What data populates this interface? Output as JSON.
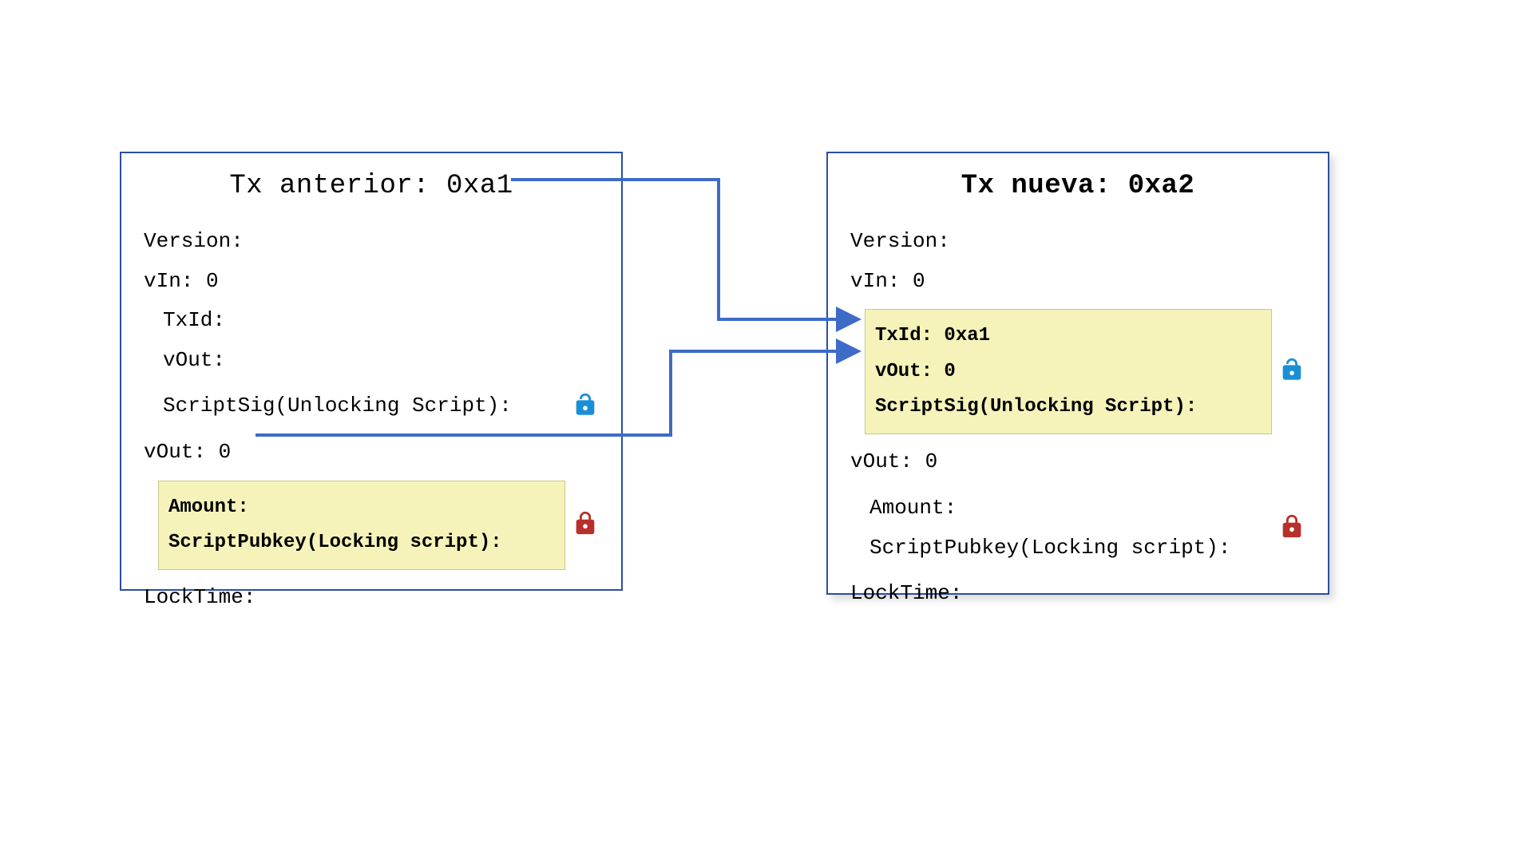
{
  "left_box": {
    "title": "Tx anterior: 0xa1",
    "version_label": "Version:",
    "vin_label": "vIn: 0",
    "txid_label": "TxId:",
    "vout_inner_label": "vOut:",
    "scriptsig_label": "ScriptSig(Unlocking Script):",
    "vout_label": "vOut: 0",
    "amount_label": "Amount:",
    "scriptpubkey_label": "ScriptPubkey(Locking script):",
    "locktime_label": "LockTime:"
  },
  "right_box": {
    "title": "Tx nueva: 0xa2",
    "version_label": "Version:",
    "vin_label": "vIn: 0",
    "txid_label": "TxId: 0xa1",
    "vout_inner_label": "vOut: 0",
    "scriptsig_label": "ScriptSig(Unlocking Script):",
    "vout_label": "vOut: 0",
    "amount_label": "Amount:",
    "scriptpubkey_label": "ScriptPubkey(Locking script):",
    "locktime_label": "LockTime:"
  },
  "icons": {
    "open_lock": "open-lock-icon",
    "closed_lock": "closed-lock-icon"
  },
  "colors": {
    "border": "#2a4f9e",
    "highlight_bg": "#f5f3b9",
    "arrow": "#3d6bc7",
    "lock_open": "#1a8fd6",
    "lock_closed": "#b8302a"
  }
}
